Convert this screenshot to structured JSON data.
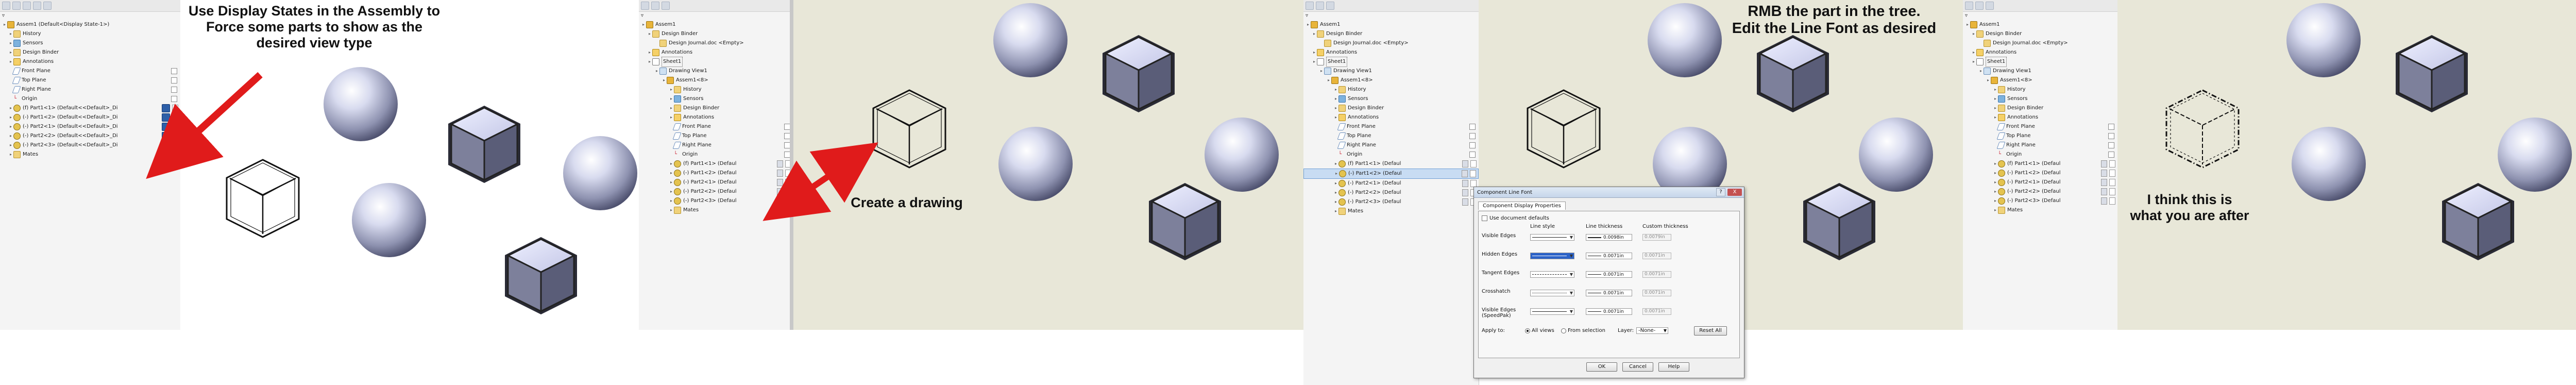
{
  "panel1": {
    "tree_rows": [
      "Assem1  (Default<Display State-1>)",
      "History",
      "Sensors",
      "Design Binder",
      "Annotations",
      "Front Plane",
      "Top Plane",
      "Right Plane",
      "Origin",
      "(f) Part1<1> (Default<<Default>_Di",
      "(-) Part1<2> (Default<<Default>_Di",
      "(-) Part2<1> (Default<<Default>_Di",
      "(-) Part2<2> (Default<<Default>_Di",
      "(-) Part2<3> (Default<<Default>_Di",
      "Mates"
    ],
    "note": "Use Display States in the Assembly to Force some parts to show as the desired view type"
  },
  "panel2": {
    "tree_rows": [
      "Assem1",
      "Design Binder",
      "Design Journal.doc <Empty>",
      "Annotations",
      "Sheet1",
      "Drawing View1",
      "Assem1<8>",
      "History",
      "Sensors",
      "Design Binder",
      "Annotations",
      "Front Plane",
      "Top Plane",
      "Right Plane",
      "Origin",
      "(f) Part1<1> (Defaul",
      "(-) Part1<2> (Defaul",
      "(-) Part2<1> (Defaul",
      "(-) Part2<2> (Defaul",
      "(-) Part2<3> (Defaul",
      "Mates"
    ],
    "note": "Create a drawing"
  },
  "panel3": {
    "tree_rows": [
      "Assem1",
      "Design Binder",
      "Design Journal.doc <Empty>",
      "Annotations",
      "Sheet1",
      "Drawing View1",
      "Assem1<8>",
      "History",
      "Sensors",
      "Design Binder",
      "Annotations",
      "Front Plane",
      "Top Plane",
      "Right Plane",
      "Origin",
      "(f) Part1<1> (Defaul",
      "(-) Part1<2> (Defaul",
      "(-) Part2<1> (Defaul",
      "(-) Part2<2> (Defaul",
      "(-) Part2<3> (Defaul",
      "Mates"
    ],
    "note": "RMB the part in the tree.\nEdit the Line Font as desired"
  },
  "dialog": {
    "title": "Component Line Font",
    "help": "?",
    "close": "X",
    "tab": "Component Display Properties",
    "use_doc_defaults": "Use document defaults",
    "col_line_style": "Line style",
    "col_line_thickness": "Line thickness",
    "col_custom_thickness": "Custom thickness",
    "rows": [
      {
        "label": "Visible Edges",
        "thickness": "0.0098in",
        "custom": "0.0079in"
      },
      {
        "label": "Hidden Edges",
        "thickness": "0.0071in",
        "custom": "0.0071in"
      },
      {
        "label": "Tangent Edges",
        "thickness": "0.0071in",
        "custom": "0.0071in"
      },
      {
        "label": "Crosshatch",
        "thickness": "0.0071in",
        "custom": "0.0071in"
      },
      {
        "label": "Visible Edges (SpeedPak)",
        "thickness": "0.0071in",
        "custom": "0.0071in"
      }
    ],
    "apply_to": "Apply to:",
    "all_views": "All views",
    "from_selection": "From selection",
    "layer_label": "Layer:",
    "layer_value": "-None-",
    "reset_all": "Reset All",
    "ok": "OK",
    "cancel": "Cancel",
    "help_btn": "Help"
  },
  "panel4": {
    "tree_rows": [
      "Assem1",
      "Design Binder",
      "Design Journal.doc <Empty>",
      "Annotations",
      "Sheet1",
      "Drawing View1",
      "Assem1<8>",
      "History",
      "Sensors",
      "Design Binder",
      "Annotations",
      "Front Plane",
      "Top Plane",
      "Right Plane",
      "Origin",
      "(f) Part1<1> (Defaul",
      "(-) Part1<2> (Defaul",
      "(-) Part2<1> (Defaul",
      "(-) Part2<2> (Defaul",
      "(-) Part2<3> (Defaul",
      "Mates"
    ],
    "note": "I think this is\nwhat you are after"
  },
  "colors": {
    "drawing_bg": "#e8e7d8",
    "model_bg": "#ffffff",
    "arrow": "#e01b1b",
    "cube_face": "#c6c9e6",
    "cube_side": "#6d7089"
  }
}
